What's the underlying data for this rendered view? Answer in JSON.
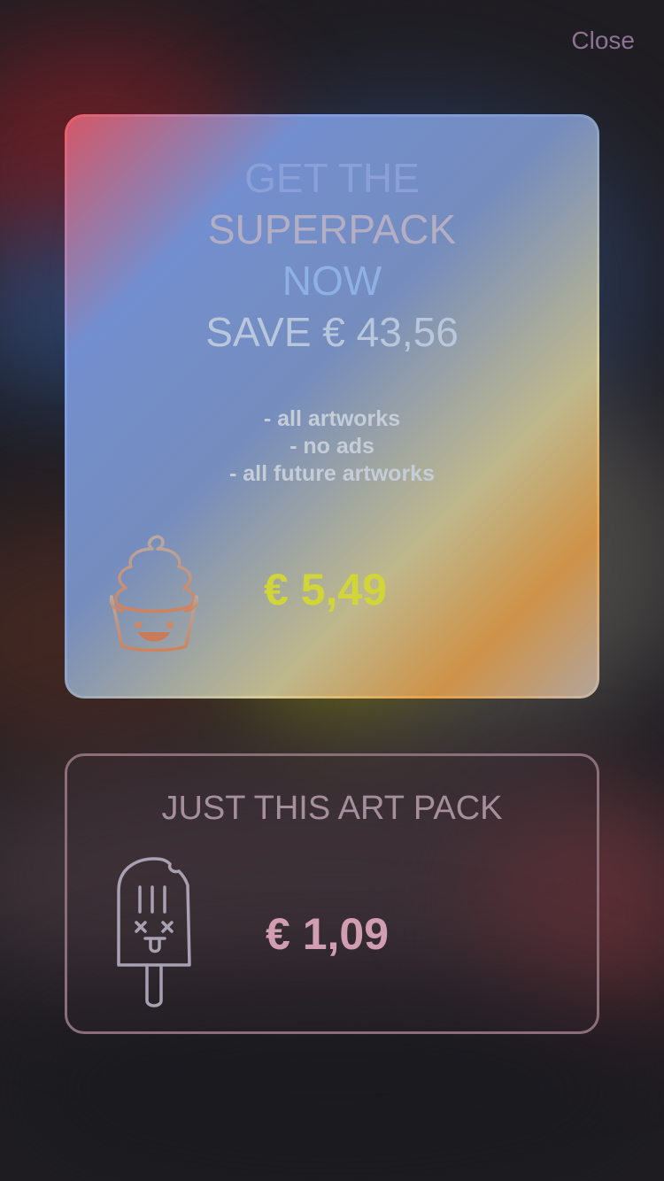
{
  "close_label": "Close",
  "superpack": {
    "headline": [
      "GET THE",
      "SUPERPACK",
      "NOW",
      "SAVE € 43,56"
    ],
    "features": [
      "- all artworks",
      "- no ads",
      "- all future artworks"
    ],
    "icon": "cupcake-icon",
    "price": "€ 5,49",
    "price_color": "#d1d538"
  },
  "single_pack": {
    "title": "JUST THIS ART PACK",
    "icon": "popsicle-icon",
    "price": "€ 1,09",
    "price_color": "#d19db0"
  }
}
